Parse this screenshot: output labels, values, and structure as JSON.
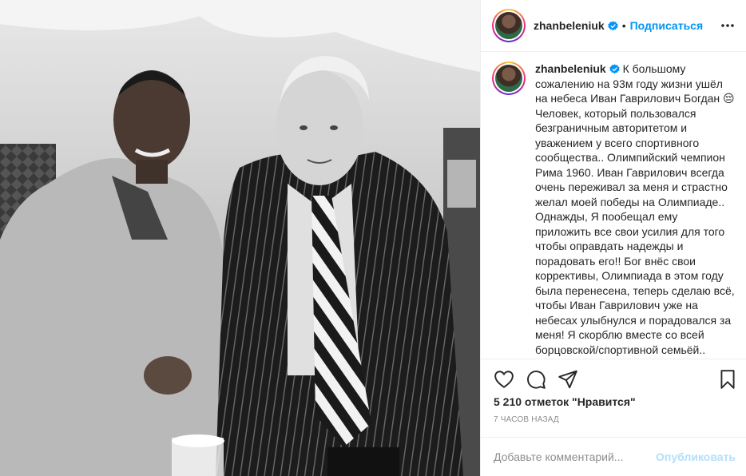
{
  "post": {
    "username": "zhanbeleniuk",
    "follow_label": "Подписаться",
    "dot": "•",
    "caption": "К большому сожалению на 93м году жизни ушёл на небеса Иван Гаврилович Богдан 😔 Человек, который пользовался безграничным авторитетом и уважением у всего спортивного сообщества.. Олимпийский чемпион Рима 1960. Иван Гаврилович всегда очень переживал за меня и страстно желал моей победы на Олимпиаде.. Однажды, Я пообещал ему приложить все свои усилия для того чтобы оправдать надежды и порадовать его!! Бог внёс свои коррективы, Олимпиада в этом году была перенесена, теперь сделаю всё, чтобы Иван Гаврилович уже на небесах улыбнулся и порадовался за меня! Я скорблю вместе со всей борцовской/спортивной семьёй..",
    "likes": "5 210 отметок \"Нравится\"",
    "time": "7 ЧАСОВ НАЗАД"
  },
  "comment": {
    "placeholder": "Добавьте комментарий...",
    "publish_label": "Опубликовать"
  },
  "icons": {
    "verified": "verified-badge-icon",
    "more": "more-horizontal-icon",
    "like": "heart-icon",
    "comment": "comment-icon",
    "share": "paper-plane-icon",
    "save": "bookmark-icon"
  },
  "colors": {
    "accent": "#0095f6",
    "publish_disabled": "#b2dffc",
    "muted": "#8e8e8e",
    "border": "#efefef"
  }
}
